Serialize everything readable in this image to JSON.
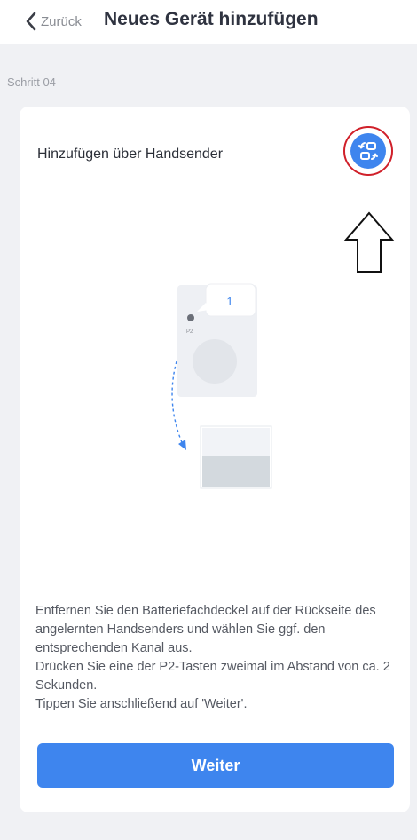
{
  "navbar": {
    "back_label": "Zurück",
    "title": "Neues Gerät hinzufügen"
  },
  "step_label": "Schritt 04",
  "card": {
    "title": "Hinzufügen über Handsender",
    "switch_icon": "switch-method-icon",
    "illustration": {
      "remote_channel_bubble": "1",
      "remote_button_label": "P2"
    },
    "instructions": [
      "Entfernen Sie den Batteriefachdeckel auf der Rückseite des angelernten Handsenders und wählen Sie ggf. den entsprechenden Kanal aus.",
      "Drücken Sie eine der P2-Tasten zweimal im Abstand von ca. 2 Sekunden.",
      "Tippen Sie anschließend auf 'Weiter'."
    ],
    "next_label": "Weiter"
  },
  "colors": {
    "accent": "#3e85ee",
    "highlight_ring": "#d0202a",
    "background": "#f0f1f4"
  }
}
